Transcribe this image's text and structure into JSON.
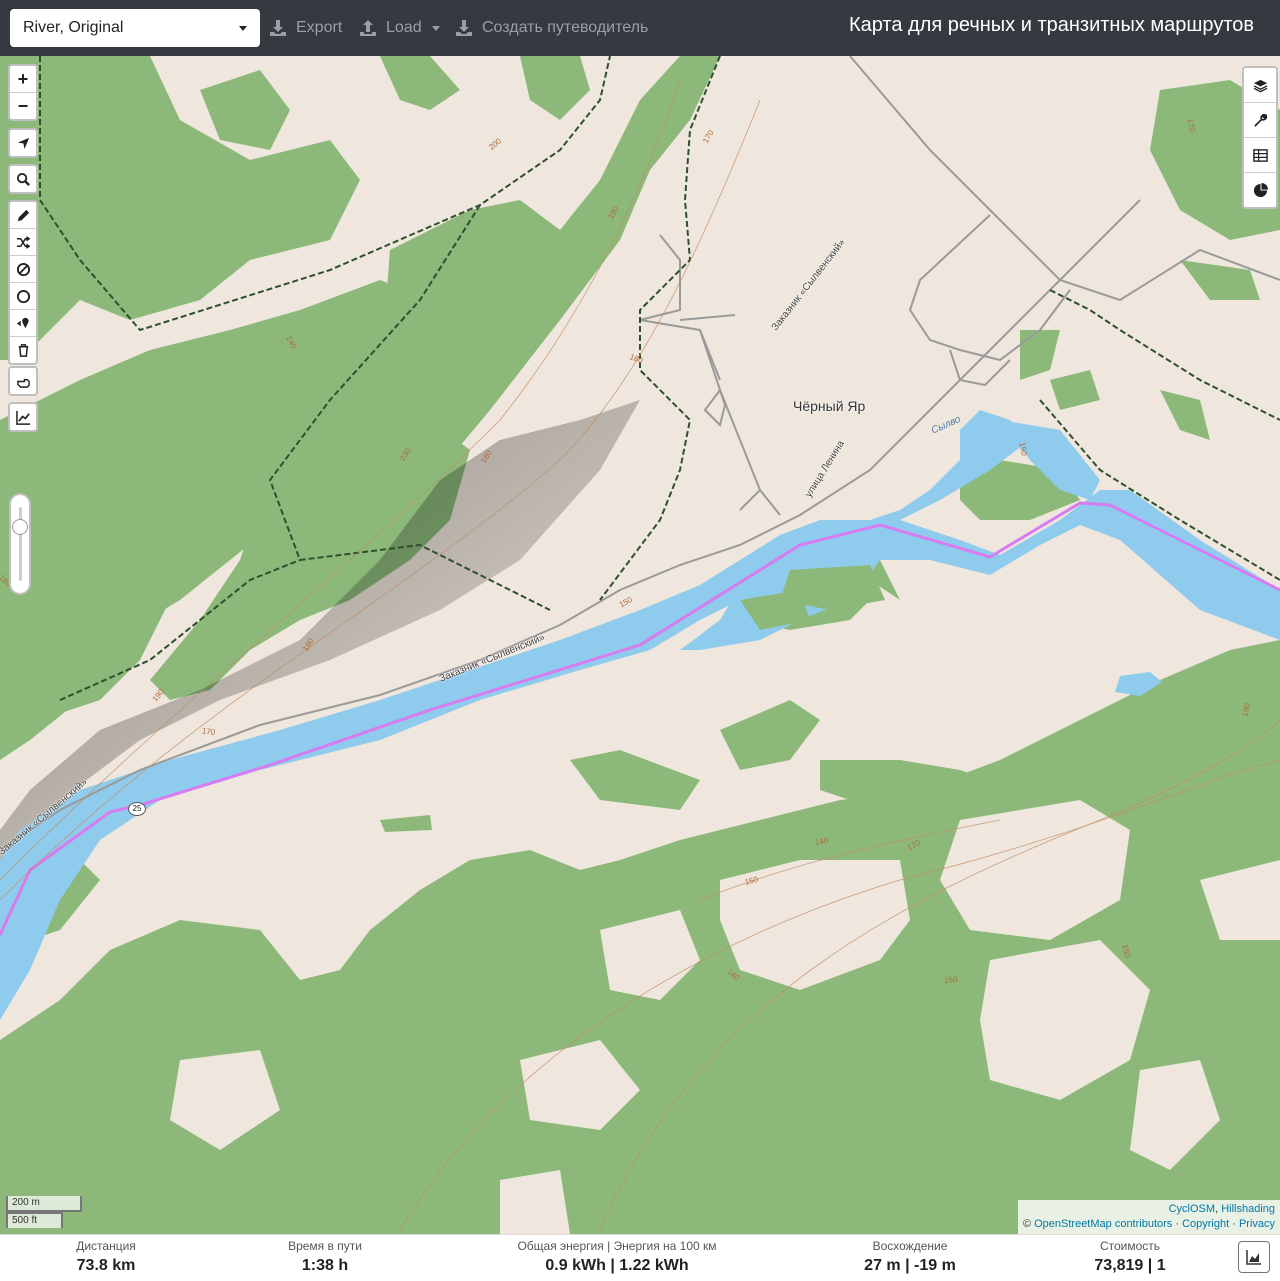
{
  "topbar": {
    "profile": "River, Original",
    "export_label": "Export",
    "load_label": "Load",
    "guide_label": "Создать путеводитель",
    "title": "Карта для речных и транзитных маршрутов"
  },
  "map": {
    "place_label": "Чёрный Яр",
    "street_label": "улица Ленина",
    "water_label": "Сылво",
    "reserve_label_1": "Заказник «Сылвенский»",
    "reserve_label_2": "Заказник «Сылвенский»",
    "reserve_label_3": "Заказник «Сылвенский»",
    "route_shield": "25",
    "contours": [
      "200",
      "190",
      "170",
      "240",
      "230",
      "180",
      "180",
      "170",
      "180",
      "170",
      "160",
      "190",
      "150",
      "150",
      "170",
      "140",
      "190",
      "150",
      "150",
      "140",
      "150"
    ],
    "route_color": "#d77bf0",
    "water_color": "#8fcbec",
    "forest_color": "#8cb97a"
  },
  "scale": {
    "metric": "200 m",
    "imperial": "500 ft"
  },
  "attribution": {
    "line1_a": "CyclOSM",
    "line1_sep": ", ",
    "line1_b": "Hillshading",
    "line2_prefix": "© ",
    "line2_osm": "OpenStreetMap contributors",
    "line2_sep1": " · ",
    "line2_copyright": "Copyright",
    "line2_sep2": " · ",
    "line2_privacy": "Privacy"
  },
  "stats": {
    "distance_label": "Дистанция",
    "distance_value": "73.8 km",
    "time_label": "Время в пути",
    "time_value": "1:38 h",
    "energy_label": "Общая энергия | Энергия на 100 км",
    "energy_value": "0.9 kWh | 1.22 kWh",
    "ascent_label": "Восхождение",
    "ascent_value": "27 m | -19 m",
    "cost_label": "Стоимость",
    "cost_value": "73,819 | 1"
  }
}
